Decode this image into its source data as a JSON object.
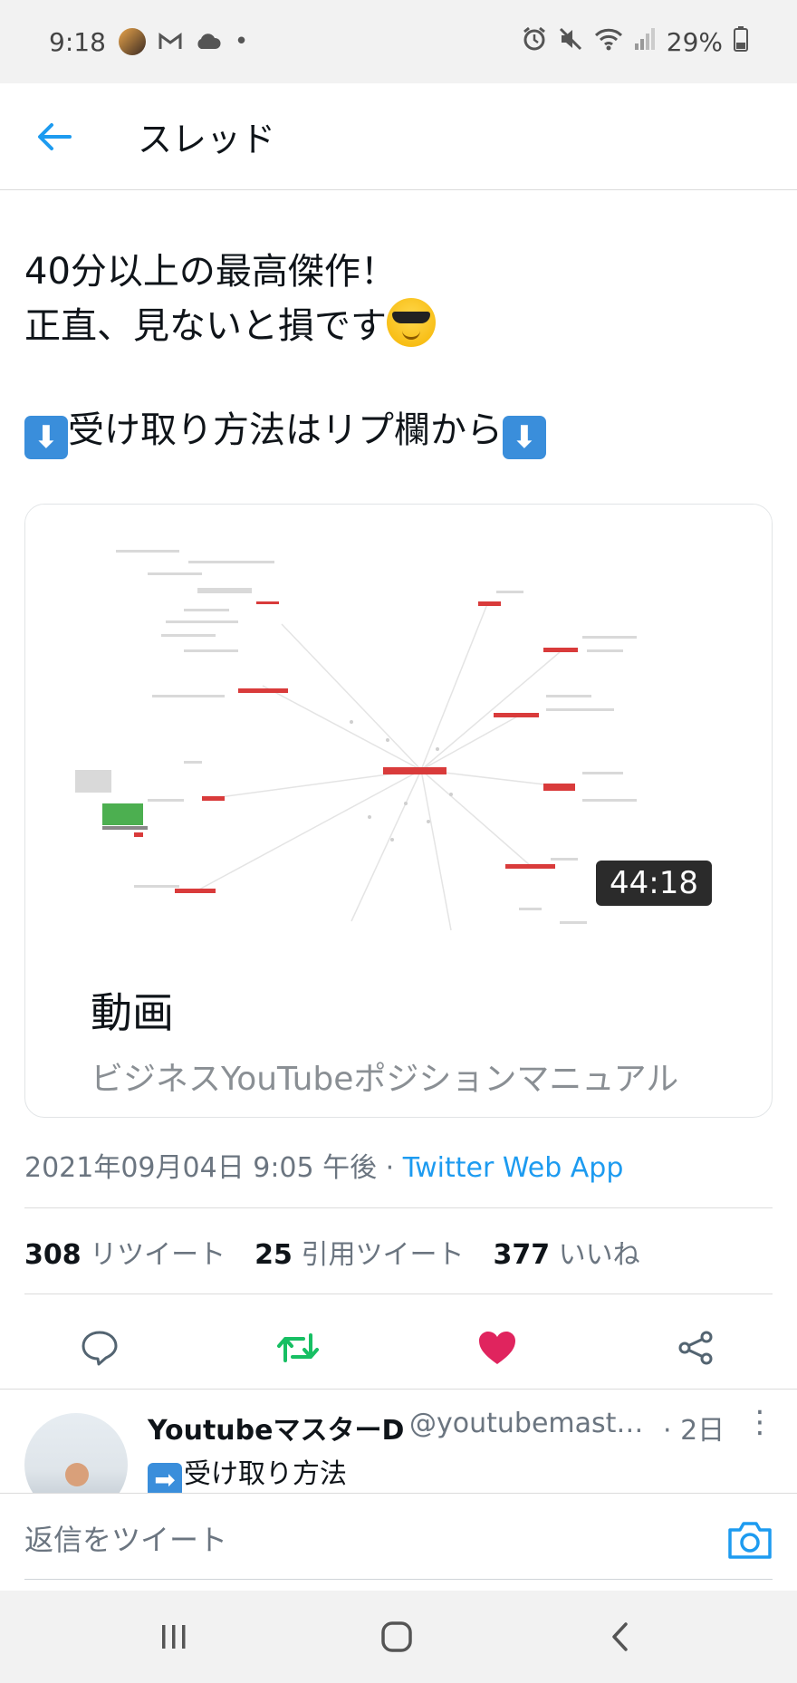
{
  "status_bar": {
    "time": "9:18",
    "battery": "29%",
    "left_icons": [
      "avatar-icon",
      "gmail-icon",
      "cloud-icon",
      "dot-icon"
    ],
    "right_icons": [
      "alarm-icon",
      "mute-icon",
      "wifi-icon",
      "signal-icon",
      "battery-icon"
    ]
  },
  "header": {
    "title": "スレッド",
    "back_icon": "arrow-left-icon",
    "accent": "#1d9bf0"
  },
  "tweet": {
    "line1": "40分以上の最高傑作！",
    "line2": "正直、見ないと損です",
    "line3": "受け取り方法はリプ欄から",
    "emoji_cool": "sunglasses-face-icon",
    "emoji_down": "down-arrow-emoji-icon"
  },
  "card": {
    "duration": "44:18",
    "type": "動画",
    "description": "ビジネスYouTubeポジションマニュアル",
    "thumbnail": "mind-map-thumbnail"
  },
  "meta": {
    "datetime": "2021年09月04日 9:05 午後",
    "separator": " · ",
    "source": "Twitter Web App"
  },
  "stats": {
    "retweets_count": "308",
    "retweets_label": "リツイート",
    "quotes_count": "25",
    "quotes_label": "引用ツイート",
    "likes_count": "377",
    "likes_label": "いいね"
  },
  "actions": {
    "reply_icon": "comment-icon",
    "retweet_icon": "retweet-icon",
    "like_icon": "heart-icon",
    "share_icon": "share-icon",
    "retweet_color": "#17bf63",
    "like_color": "#e0245e"
  },
  "reply": {
    "name": "YoutubeマスターD",
    "handle": "@youtubemasterd",
    "time": "· 2日",
    "text": "受け取り方法",
    "more_icon": "more-vertical-icon"
  },
  "composer": {
    "placeholder": "返信をツイート",
    "camera_icon": "camera-icon"
  },
  "navbar": {
    "recents_icon": "recents-icon",
    "home_icon": "home-icon",
    "back_icon": "nav-back-icon"
  }
}
